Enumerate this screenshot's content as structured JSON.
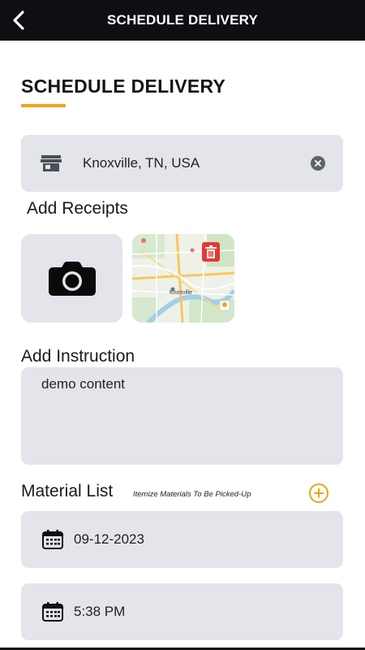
{
  "header": {
    "title": "SCHEDULE DELIVERY"
  },
  "page": {
    "heading": "SCHEDULE DELIVERY",
    "accent_color": "#f2a31b"
  },
  "location": {
    "value": "Knoxville, TN, USA",
    "icon": "store-icon"
  },
  "receipts": {
    "label": "Add Receipts",
    "camera_icon": "camera-icon",
    "attachments": [
      {
        "type": "map-image",
        "map_label": "Knoxville"
      }
    ]
  },
  "instruction": {
    "label": "Add Instruction",
    "value": "demo content"
  },
  "materials": {
    "label": "Material List",
    "hint": "Itemize Materials To Be Picked-Up"
  },
  "date": {
    "value": "09-12-2023",
    "icon": "calendar-icon"
  },
  "time": {
    "value": "5:38 PM",
    "icon": "calendar-icon"
  }
}
